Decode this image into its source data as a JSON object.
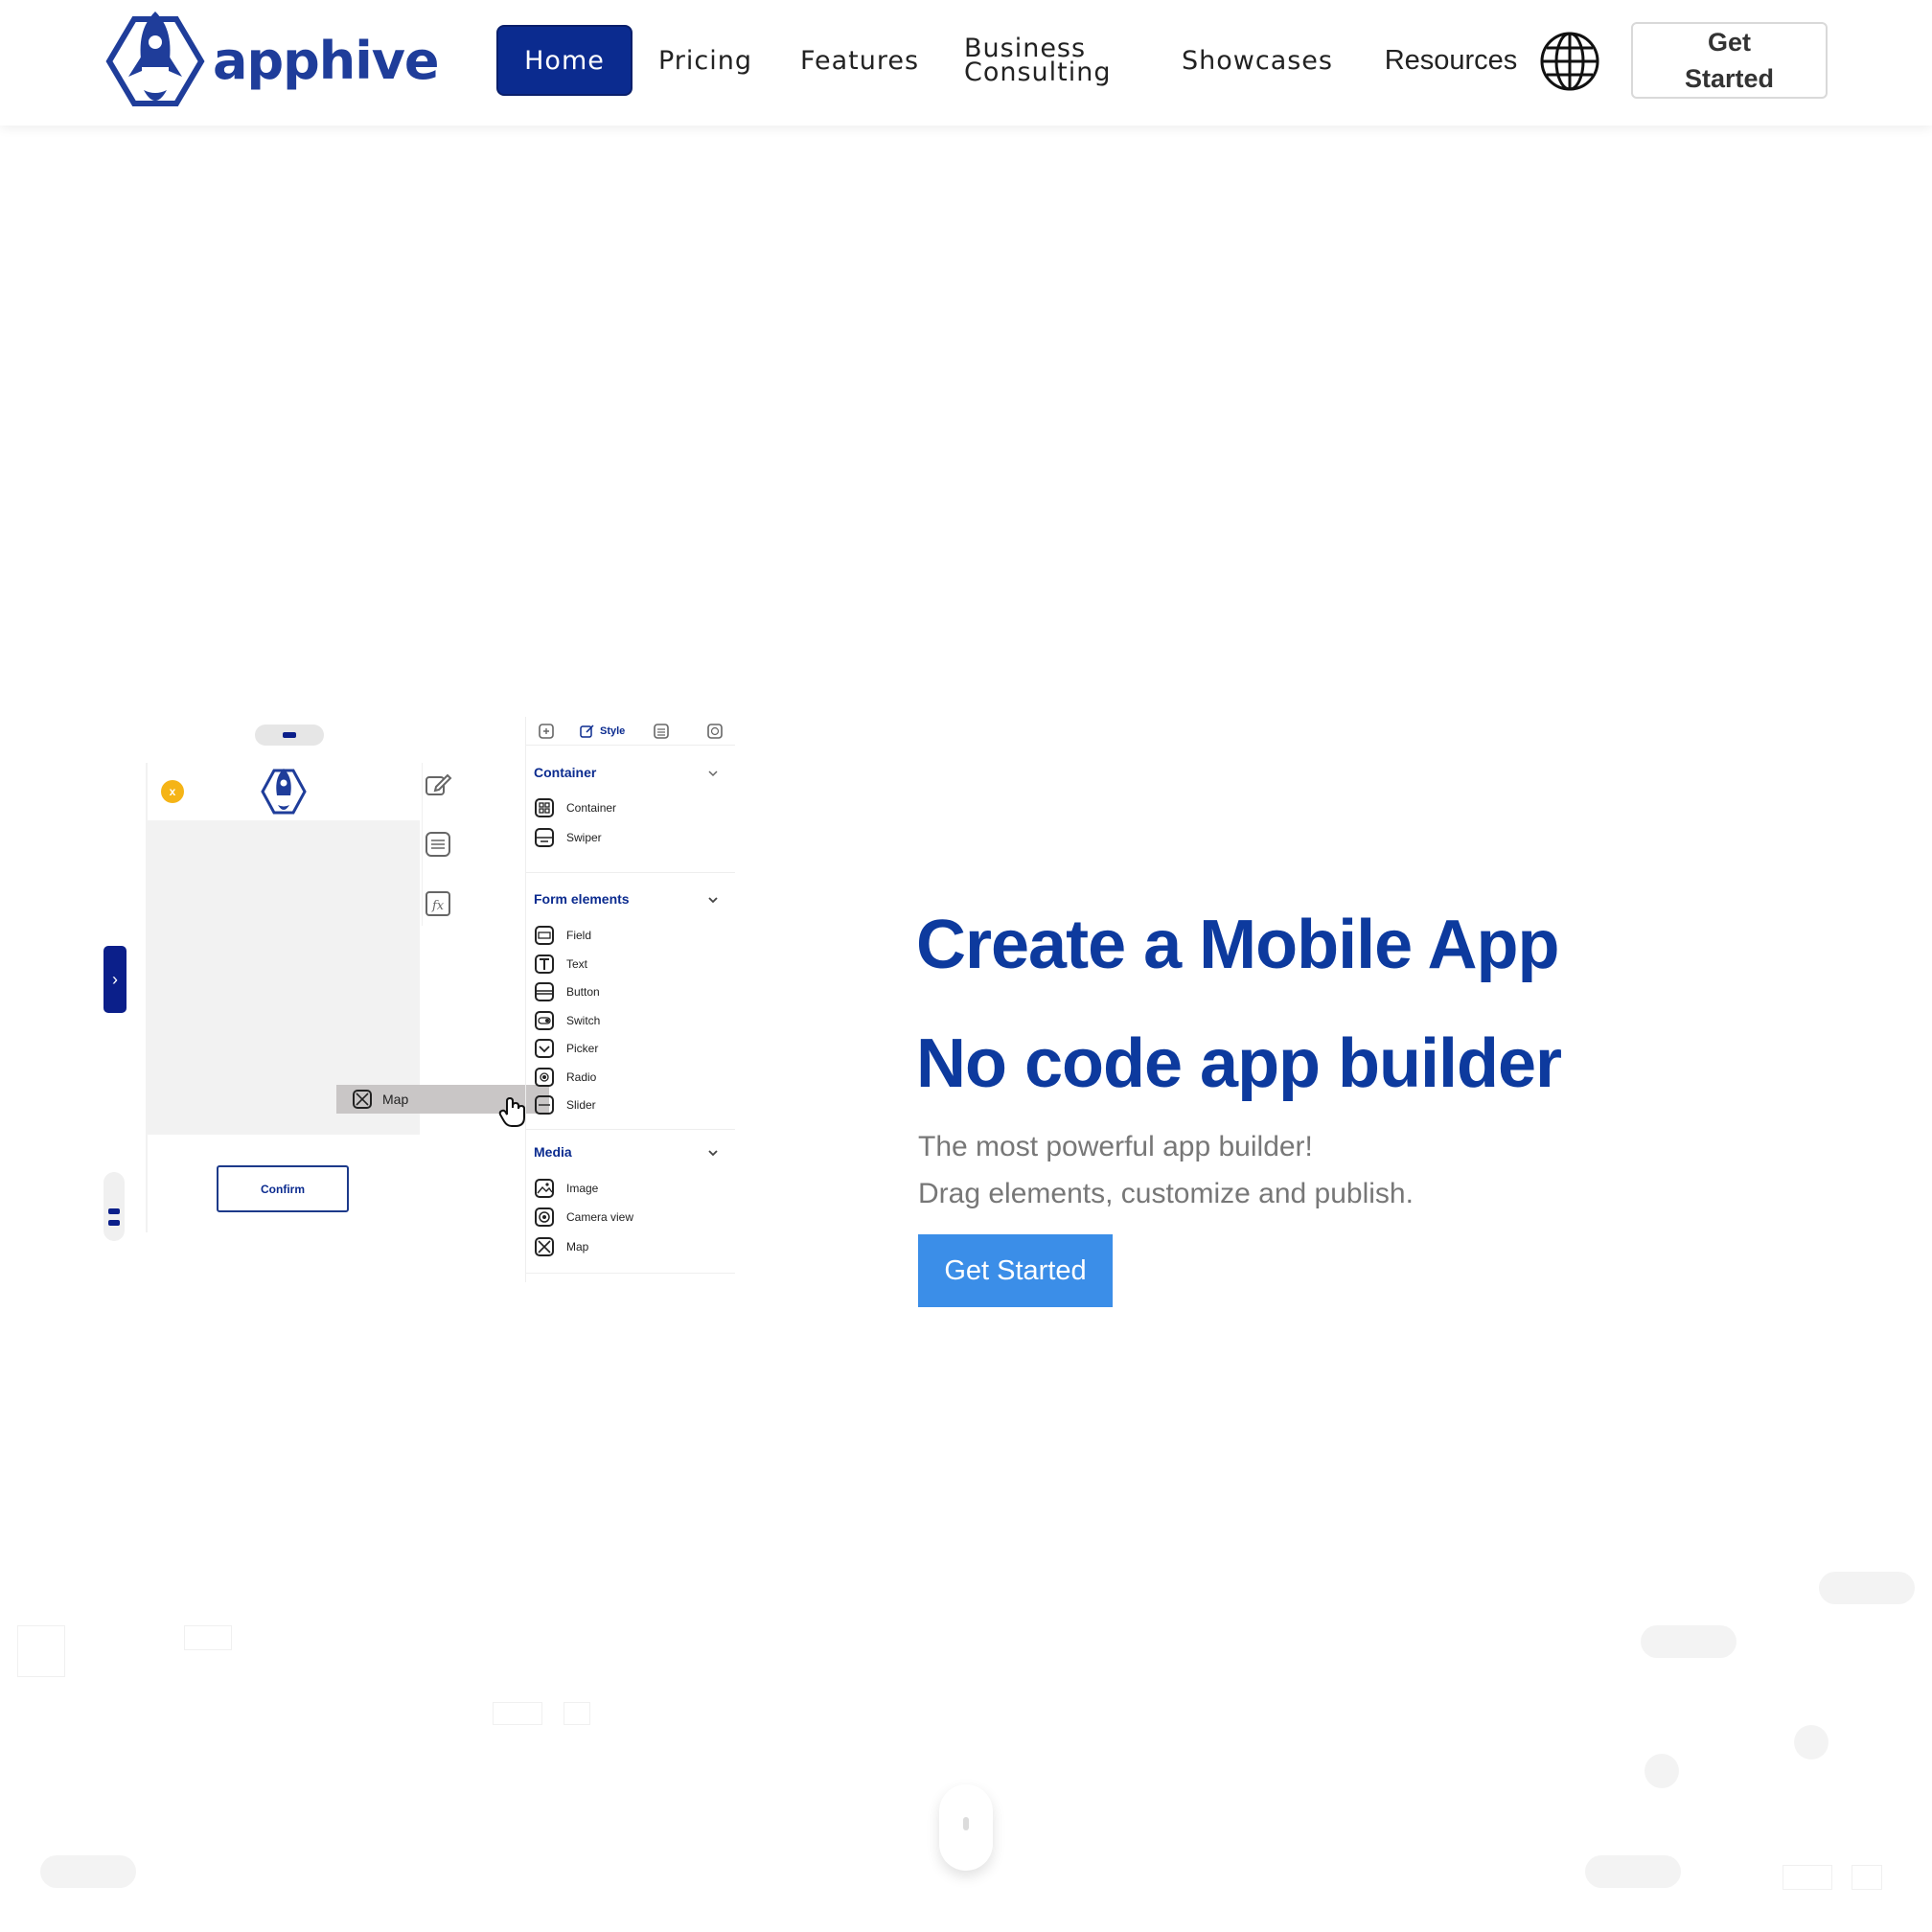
{
  "brand": {
    "name": "apphive",
    "color": "#1f3d9a"
  },
  "nav": {
    "items": [
      {
        "label": "Home",
        "active": true
      },
      {
        "label": "Pricing"
      },
      {
        "label": "Features"
      },
      {
        "label_line1": "Business",
        "label_line2": "Consulting"
      },
      {
        "label": "Showcases"
      },
      {
        "label": "Resources"
      }
    ],
    "language_icon": "globe-icon",
    "cta_line1": "Get",
    "cta_line2": "Started"
  },
  "illustration": {
    "close_badge": "x",
    "confirm_label": "Confirm",
    "dragging_item": "Map",
    "panel": {
      "tab_style": "Style",
      "sections": [
        {
          "title": "Container",
          "items": [
            "Container",
            "Swiper"
          ]
        },
        {
          "title": "Form elements",
          "items": [
            "Field",
            "Text",
            "Button",
            "Switch",
            "Picker",
            "Radio",
            "Slider"
          ]
        },
        {
          "title": "Media",
          "items": [
            "Image",
            "Camera view",
            "Map"
          ]
        }
      ]
    }
  },
  "hero": {
    "title_line1": "Create a Mobile App",
    "title_line2": "No code app builder",
    "subtitle_line1": "The most powerful app builder!",
    "subtitle_line2": "Drag elements, customize and publish.",
    "cta": "Get Started"
  },
  "colors": {
    "primary": "#0b2b8f",
    "accent": "#3b8ee8",
    "heading": "#0d3a9e"
  }
}
